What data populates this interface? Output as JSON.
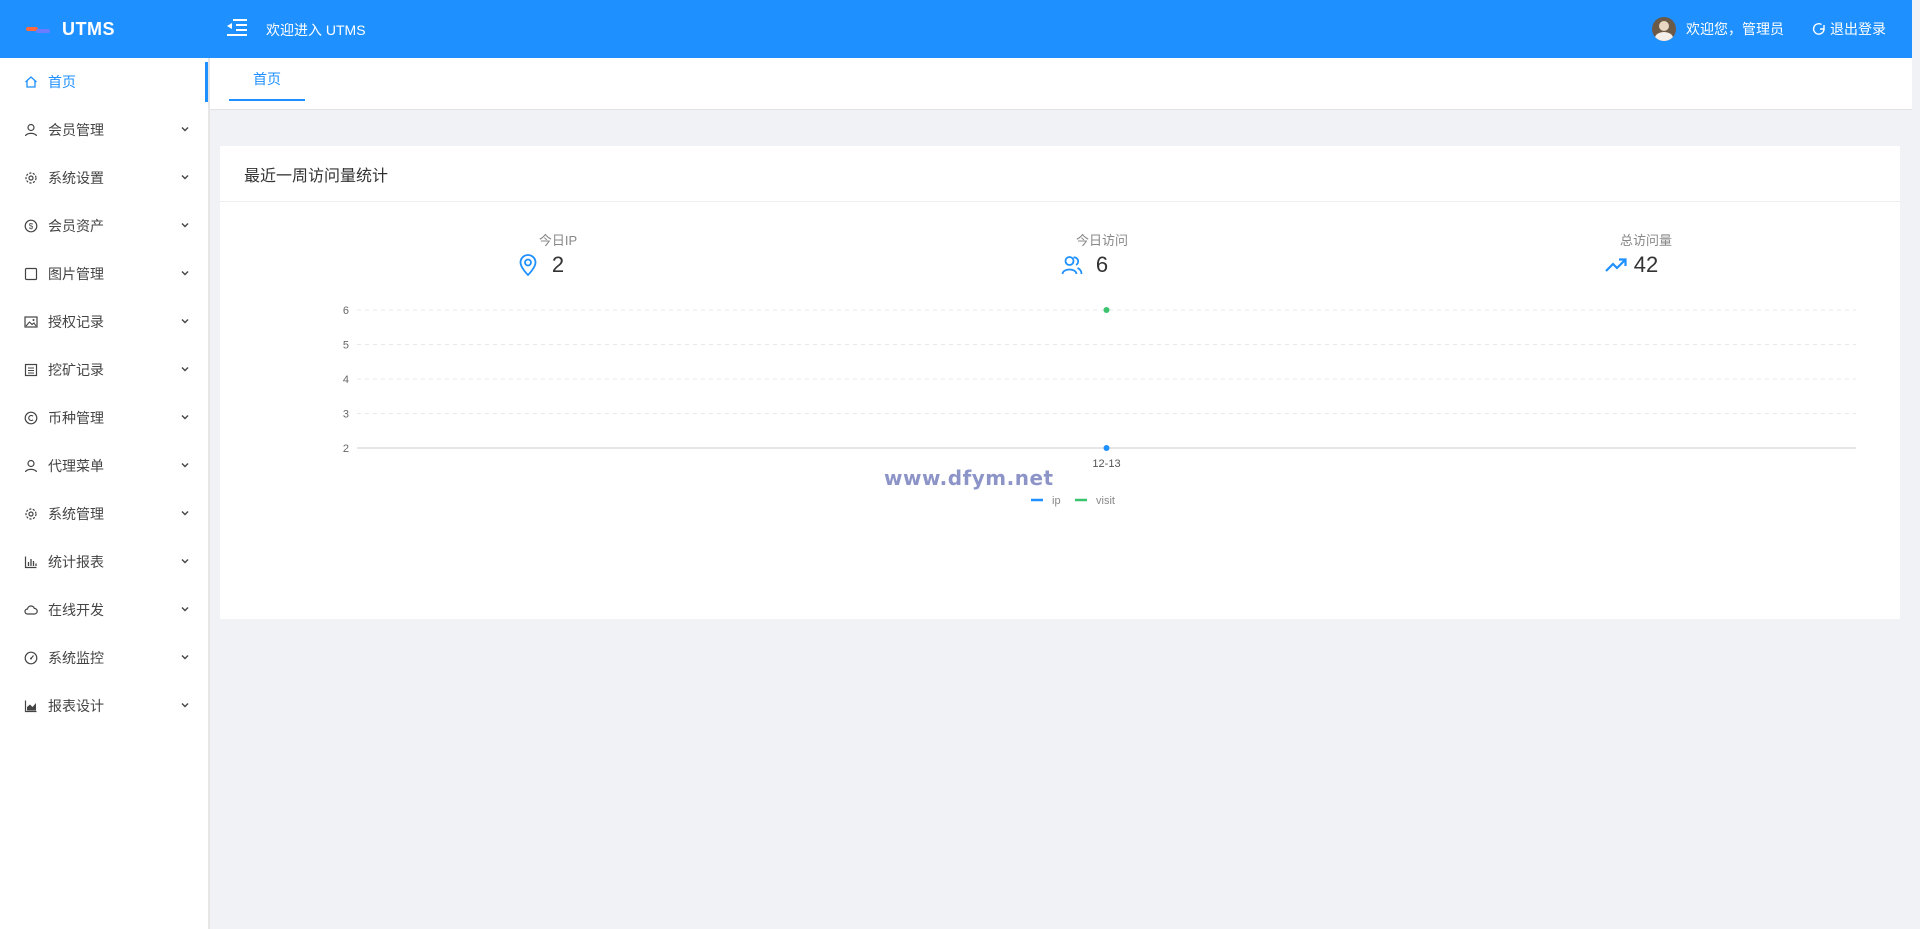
{
  "header": {
    "logo_text": "UTMS",
    "welcome": "欢迎进入 UTMS",
    "greeting": "欢迎您，管理员",
    "logout": "退出登录"
  },
  "sidebar": {
    "items": [
      {
        "label": "首页",
        "icon": "home-icon",
        "active": true
      },
      {
        "label": "会员管理",
        "icon": "user-icon"
      },
      {
        "label": "系统设置",
        "icon": "gear-icon"
      },
      {
        "label": "会员资产",
        "icon": "dollar-circle-icon"
      },
      {
        "label": "图片管理",
        "icon": "square-icon"
      },
      {
        "label": "授权记录",
        "icon": "image-icon"
      },
      {
        "label": "挖矿记录",
        "icon": "list-box-icon"
      },
      {
        "label": "币种管理",
        "icon": "copyright-icon"
      },
      {
        "label": "代理菜单",
        "icon": "user-icon"
      },
      {
        "label": "系统管理",
        "icon": "gear-icon"
      },
      {
        "label": "统计报表",
        "icon": "bar-chart-icon"
      },
      {
        "label": "在线开发",
        "icon": "cloud-icon"
      },
      {
        "label": "系统监控",
        "icon": "dashboard-icon"
      },
      {
        "label": "报表设计",
        "icon": "area-chart-icon"
      }
    ]
  },
  "tabs": [
    {
      "label": "首页"
    }
  ],
  "card": {
    "title": "最近一周访问量统计",
    "stats": [
      {
        "label": "今日IP",
        "value": "2",
        "icon": "location-pin-icon"
      },
      {
        "label": "今日访问",
        "value": "6",
        "icon": "users-icon"
      },
      {
        "label": "总访问量",
        "value": "42",
        "icon": "trending-up-icon"
      }
    ]
  },
  "chart_data": {
    "type": "line",
    "categories": [
      "12-13"
    ],
    "series": [
      {
        "name": "ip",
        "values": [
          2
        ],
        "color": "#1e90ff"
      },
      {
        "name": "visit",
        "values": [
          6
        ],
        "color": "#3cc36e"
      }
    ],
    "yticks": [
      2,
      3,
      4,
      5,
      6
    ],
    "ylim": [
      2,
      6
    ],
    "grid": true,
    "legend": "bottom-center"
  },
  "watermark": "www.dfym.net",
  "colors": {
    "primary": "#1e90ff",
    "visit": "#3cc36e"
  }
}
